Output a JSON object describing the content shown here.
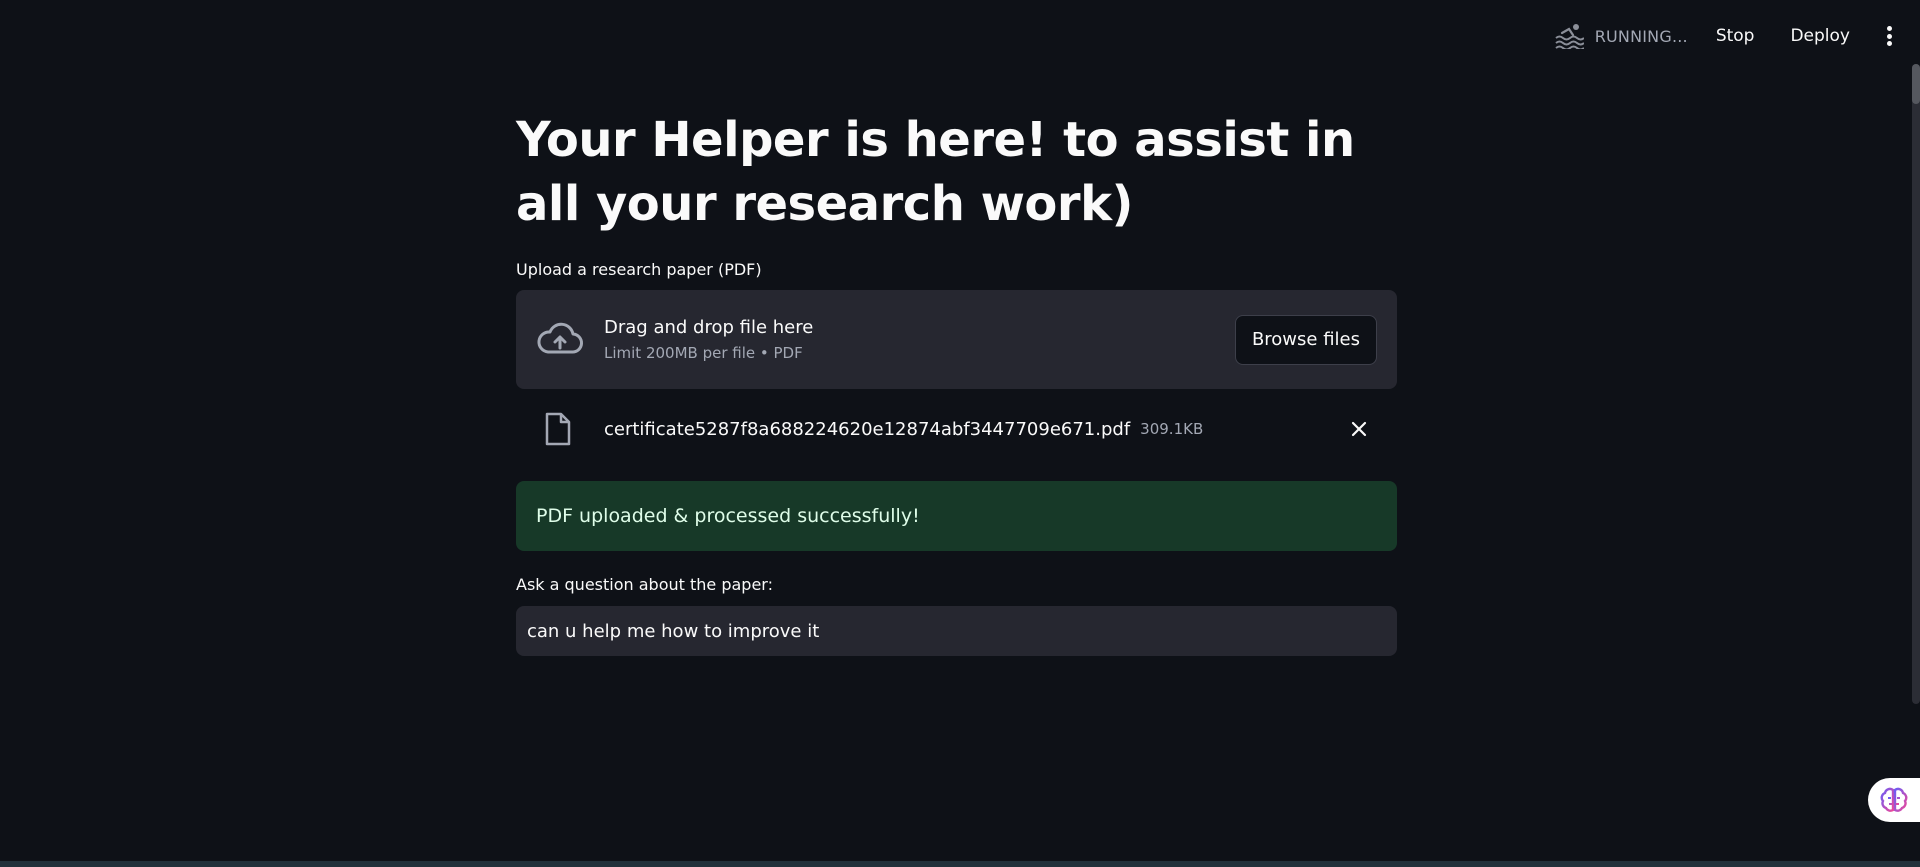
{
  "toolbar": {
    "status_text": "RUNNING...",
    "status_icon": "swimming-icon",
    "stop_label": "Stop",
    "deploy_label": "Deploy",
    "menu_icon": "vertical-dots-icon"
  },
  "main": {
    "title": "Your Helper is here! to assist in all your research work)",
    "uploader": {
      "label": "Upload a research paper (PDF)",
      "icon": "cloud-upload-icon",
      "dropzone_title": "Drag and drop file here",
      "dropzone_limit": "Limit 200MB per file • PDF",
      "browse_label": "Browse files"
    },
    "uploaded_file": {
      "icon": "file-icon",
      "name": "certificate5287f8a688224620e12874abf3447709e671.pdf",
      "size": "309.1KB",
      "remove_icon": "close-icon"
    },
    "success_message": "PDF uploaded & processed successfully!",
    "question": {
      "label": "Ask a question about the paper:",
      "value": "can u help me how to improve it"
    }
  },
  "colors": {
    "background": "#0e1117",
    "surface": "#262730",
    "success_bg": "#173928",
    "success_text": "#dffde9",
    "muted_text": "#a3a8b4"
  },
  "floating_widget": {
    "icon": "brain-icon"
  }
}
